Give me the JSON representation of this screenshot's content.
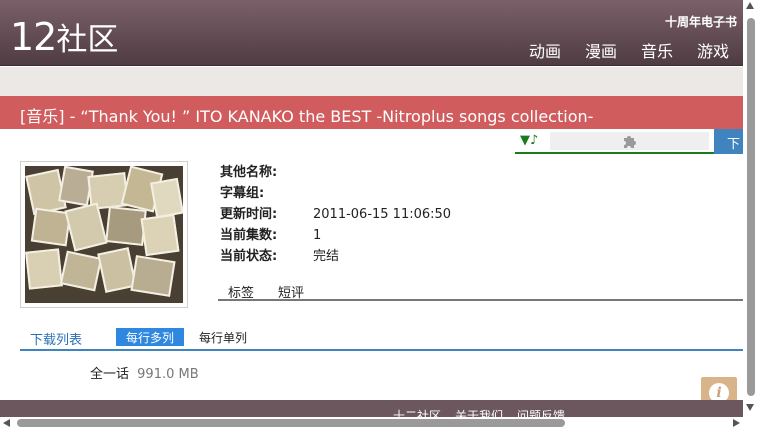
{
  "header": {
    "logo_number": "12",
    "logo_text": "社区",
    "ebook_link": "十周年电子书",
    "nav": [
      "动画",
      "漫画",
      "音乐",
      "游戏"
    ]
  },
  "release": {
    "title": "[音乐] - “Thank You! ” ITO KANAKO the BEST -Nitroplus songs collection-"
  },
  "download_tools": {
    "music_icon": "▼♪",
    "plugin_icon": "puzzle-icon",
    "download_label": "下载"
  },
  "details": [
    {
      "label": "其他名称:",
      "value": ""
    },
    {
      "label": "字幕组:",
      "value": ""
    },
    {
      "label": "更新时间:",
      "value": "2011-06-15 11:06:50"
    },
    {
      "label": "当前集数:",
      "value": "1"
    },
    {
      "label": "当前状态:",
      "value": "完结"
    }
  ],
  "tabs": [
    "标签",
    "短评"
  ],
  "download_list": {
    "title": "下载列表",
    "view_multi": "每行多列",
    "view_single": "每行单列",
    "items": [
      {
        "name": "全一话",
        "size": "991.0 MB"
      }
    ]
  },
  "footer": {
    "links": [
      "十二社区",
      "关于我们",
      "问题反馈"
    ]
  },
  "colors": {
    "header": "#5f4a51",
    "title_bar": "#d05c5e",
    "accent_blue": "#3f84bf",
    "player_green": "#1e7a1e",
    "info_button": "#d9b48a"
  }
}
